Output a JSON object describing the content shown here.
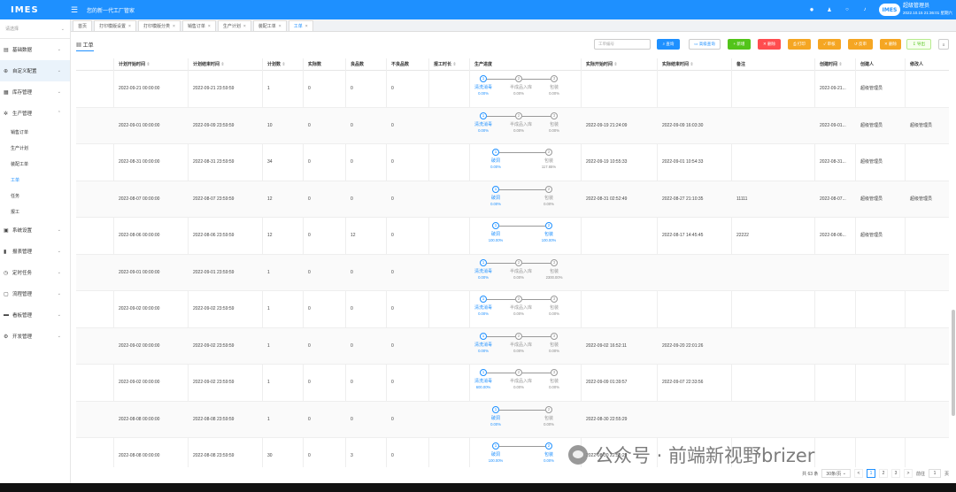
{
  "app": {
    "logo": "IMES",
    "title": "您的新一代工厂管家",
    "user_logo": "IMES",
    "user_name": "超级管理员",
    "user_time": "2022.10.15 21:36:01 星期六"
  },
  "header_icons": [
    "settings-icon",
    "user-icon",
    "refresh-icon",
    "bell-icon"
  ],
  "sidebar": {
    "select_placeholder": "请选择",
    "items": [
      {
        "label": "基础数据",
        "icon": "database-icon",
        "expanded": false
      },
      {
        "label": "自定义配置",
        "icon": "config-icon",
        "expanded": false,
        "highlight": true
      },
      {
        "label": "库存管理",
        "icon": "warehouse-icon",
        "expanded": false
      },
      {
        "label": "生产管理",
        "icon": "gear-icon",
        "expanded": true
      },
      {
        "label": "系统设置",
        "icon": "system-icon",
        "expanded": false
      },
      {
        "label": "报表管理",
        "icon": "chart-icon",
        "expanded": false
      },
      {
        "label": "定时任务",
        "icon": "clock-icon",
        "expanded": false
      },
      {
        "label": "流程管理",
        "icon": "flow-icon",
        "expanded": false
      },
      {
        "label": "看板管理",
        "icon": "monitor-icon",
        "expanded": false
      },
      {
        "label": "开发管理",
        "icon": "code-icon",
        "expanded": false
      }
    ],
    "production_sub": [
      "销售订单",
      "生产计划",
      "装配工单",
      "工单",
      "任务",
      "报工"
    ],
    "active_sub": "工单"
  },
  "tabs": [
    {
      "label": "首页",
      "closable": false
    },
    {
      "label": "打印模版设置",
      "closable": true
    },
    {
      "label": "打印模版分类",
      "closable": true
    },
    {
      "label": "销售订单",
      "closable": true
    },
    {
      "label": "生产计划",
      "closable": true
    },
    {
      "label": "装配工单",
      "closable": true
    },
    {
      "label": "工单",
      "closable": true,
      "active": true
    }
  ],
  "toolbar": {
    "panel_title": "工单",
    "search_placeholder": "工单编号",
    "buttons": [
      {
        "label": "查询",
        "color": "#1e90ff",
        "text": "#ffffff"
      },
      {
        "label": "高级查询",
        "color": "#ffffff",
        "text": "#1e90ff"
      },
      {
        "label": "新增",
        "color": "#52c41a",
        "text": "#ffffff"
      },
      {
        "label": "删除",
        "color": "#ff4d4f",
        "text": "#ffffff"
      },
      {
        "label": "打印",
        "color": "#f5a623",
        "text": "#ffffff"
      },
      {
        "label": "审核",
        "color": "#f5a623",
        "text": "#ffffff"
      },
      {
        "label": "反审",
        "color": "#f5a623",
        "text": "#ffffff"
      },
      {
        "label": "删除",
        "color": "#f5a623",
        "text": "#ffffff"
      },
      {
        "label": "导出",
        "color": "#f6ffed",
        "text": "#52c41a"
      },
      {
        "label": "≡",
        "color": "#ffffff",
        "text": "#555555"
      }
    ]
  },
  "table": {
    "columns": [
      "计划开始时间",
      "计划结束时间",
      "计划数",
      "实际数",
      "良品数",
      "不良品数",
      "报工时长",
      "生产进度",
      "实际开始时间",
      "实际结束时间",
      "备注",
      "创建时间",
      "创建人",
      "修改人"
    ],
    "rows": [
      {
        "plan_start": "2022-09-21 00:00:00",
        "plan_end": "2022-09-21 23:59:59",
        "plan_qty": "1",
        "actual_qty": "0",
        "good_qty": "0",
        "bad_qty": "0",
        "duration": "",
        "steps": [
          {
            "name": "清洗消毒",
            "pct": "0.00%",
            "done": true
          },
          {
            "name": "半成品入库",
            "pct": "0.00%",
            "done": false
          },
          {
            "name": "包装",
            "pct": "0.00%",
            "done": false
          }
        ],
        "actual_start": "",
        "actual_end": "",
        "remark": "",
        "created": "2022-09-21...",
        "creator": "超级管理员",
        "modifier": ""
      },
      {
        "plan_start": "2022-09-01 00:00:00",
        "plan_end": "2022-09-09 23:59:59",
        "plan_qty": "10",
        "actual_qty": "0",
        "good_qty": "0",
        "bad_qty": "0",
        "duration": "",
        "steps": [
          {
            "name": "清洗消毒",
            "pct": "0.00%",
            "done": true
          },
          {
            "name": "半成品入库",
            "pct": "0.00%",
            "done": false
          },
          {
            "name": "包装",
            "pct": "0.00%",
            "done": false
          }
        ],
        "actual_start": "2022-09-19 21:24:09",
        "actual_end": "2022-09-09 16:03:30",
        "remark": "",
        "created": "2022-09-01...",
        "creator": "超级管理员",
        "modifier": "超级管理员"
      },
      {
        "plan_start": "2022-08-31 00:00:00",
        "plan_end": "2022-08-31 23:59:59",
        "plan_qty": "34",
        "actual_qty": "0",
        "good_qty": "0",
        "bad_qty": "0",
        "duration": "",
        "steps": [
          {
            "name": "破洞",
            "pct": "0.00%",
            "done": true
          },
          {
            "name": "包装",
            "pct": "117.65%",
            "done": false
          }
        ],
        "actual_start": "2022-09-19 10:55:33",
        "actual_end": "2022-09-01 10:54:33",
        "remark": "",
        "created": "2022-08-31...",
        "creator": "超级管理员",
        "modifier": ""
      },
      {
        "plan_start": "2022-08-07 00:00:00",
        "plan_end": "2022-08-07 23:59:59",
        "plan_qty": "12",
        "actual_qty": "0",
        "good_qty": "0",
        "bad_qty": "0",
        "duration": "",
        "steps": [
          {
            "name": "破洞",
            "pct": "0.00%",
            "done": true
          },
          {
            "name": "包装",
            "pct": "0.00%",
            "done": false
          }
        ],
        "actual_start": "2022-08-31 02:52:49",
        "actual_end": "2022-08-27 21:10:35",
        "remark": "11111",
        "created": "2022-08-07...",
        "creator": "超级管理员",
        "modifier": "超级管理员"
      },
      {
        "plan_start": "2022-08-06 00:00:00",
        "plan_end": "2022-08-06 23:59:59",
        "plan_qty": "12",
        "actual_qty": "0",
        "good_qty": "12",
        "bad_qty": "0",
        "duration": "",
        "steps": [
          {
            "name": "破洞",
            "pct": "100.00%",
            "done": true
          },
          {
            "name": "包装",
            "pct": "100.00%",
            "done": true
          }
        ],
        "actual_start": "",
        "actual_end": "2022-08-17 14:45:45",
        "remark": "22222",
        "created": "2022-08-06...",
        "creator": "超级管理员",
        "modifier": ""
      },
      {
        "plan_start": "2022-09-01 00:00:00",
        "plan_end": "2022-09-01 23:59:59",
        "plan_qty": "1",
        "actual_qty": "0",
        "good_qty": "0",
        "bad_qty": "0",
        "duration": "",
        "steps": [
          {
            "name": "清洗消毒",
            "pct": "0.00%",
            "done": true
          },
          {
            "name": "半成品入库",
            "pct": "0.00%",
            "done": false
          },
          {
            "name": "包装",
            "pct": "2300.00%",
            "done": false
          }
        ],
        "actual_start": "",
        "actual_end": "",
        "remark": "",
        "created": "",
        "creator": "",
        "modifier": ""
      },
      {
        "plan_start": "2022-09-02 00:00:00",
        "plan_end": "2022-09-02 23:59:59",
        "plan_qty": "1",
        "actual_qty": "0",
        "good_qty": "0",
        "bad_qty": "0",
        "duration": "",
        "steps": [
          {
            "name": "清洗消毒",
            "pct": "0.00%",
            "done": true
          },
          {
            "name": "半成品入库",
            "pct": "0.00%",
            "done": false
          },
          {
            "name": "包装",
            "pct": "0.00%",
            "done": false
          }
        ],
        "actual_start": "",
        "actual_end": "",
        "remark": "",
        "created": "",
        "creator": "",
        "modifier": ""
      },
      {
        "plan_start": "2022-09-02 00:00:00",
        "plan_end": "2022-09-02 23:59:59",
        "plan_qty": "1",
        "actual_qty": "0",
        "good_qty": "0",
        "bad_qty": "0",
        "duration": "",
        "steps": [
          {
            "name": "清洗消毒",
            "pct": "0.00%",
            "done": true
          },
          {
            "name": "半成品入库",
            "pct": "0.00%",
            "done": false
          },
          {
            "name": "包装",
            "pct": "0.00%",
            "done": false
          }
        ],
        "actual_start": "2022-09-02 16:52:11",
        "actual_end": "2022-09-20 22:01:26",
        "remark": "",
        "created": "",
        "creator": "",
        "modifier": ""
      },
      {
        "plan_start": "2022-09-02 00:00:00",
        "plan_end": "2022-09-02 23:59:59",
        "plan_qty": "1",
        "actual_qty": "0",
        "good_qty": "0",
        "bad_qty": "0",
        "duration": "",
        "steps": [
          {
            "name": "清洗消毒",
            "pct": "600.00%",
            "done": true
          },
          {
            "name": "半成品入库",
            "pct": "0.00%",
            "done": false
          },
          {
            "name": "包装",
            "pct": "0.00%",
            "done": false
          }
        ],
        "actual_start": "2022-09-09 01:39:57",
        "actual_end": "2022-09-07 22:33:56",
        "remark": "",
        "created": "",
        "creator": "",
        "modifier": ""
      },
      {
        "plan_start": "2022-08-08 00:00:00",
        "plan_end": "2022-08-08 23:59:59",
        "plan_qty": "1",
        "actual_qty": "0",
        "good_qty": "0",
        "bad_qty": "0",
        "duration": "",
        "steps": [
          {
            "name": "破洞",
            "pct": "0.00%",
            "done": true
          },
          {
            "name": "包装",
            "pct": "0.00%",
            "done": false
          }
        ],
        "actual_start": "2022-08-30 22:55:29",
        "actual_end": "",
        "remark": "",
        "created": "",
        "creator": "",
        "modifier": ""
      },
      {
        "plan_start": "2022-08-08 00:00:00",
        "plan_end": "2022-08-08 23:59:59",
        "plan_qty": "30",
        "actual_qty": "0",
        "good_qty": "3",
        "bad_qty": "0",
        "duration": "",
        "steps": [
          {
            "name": "破洞",
            "pct": "100.00%",
            "done": true
          },
          {
            "name": "包装",
            "pct": "0.00%",
            "done": true
          }
        ],
        "actual_start": "2022-08-30 22:55:29",
        "actual_end": "",
        "remark": "",
        "created": "",
        "creator": "",
        "modifier": ""
      }
    ]
  },
  "pagination": {
    "total": "共 63 条",
    "page_size": "30条/页",
    "prev": "<",
    "pages": [
      "1",
      "2",
      "3"
    ],
    "current": "1",
    "next": ">",
    "goto_label": "前往",
    "goto_value": "1",
    "goto_suffix": "页"
  },
  "watermark": "公众号 · 前端新视野brizer"
}
